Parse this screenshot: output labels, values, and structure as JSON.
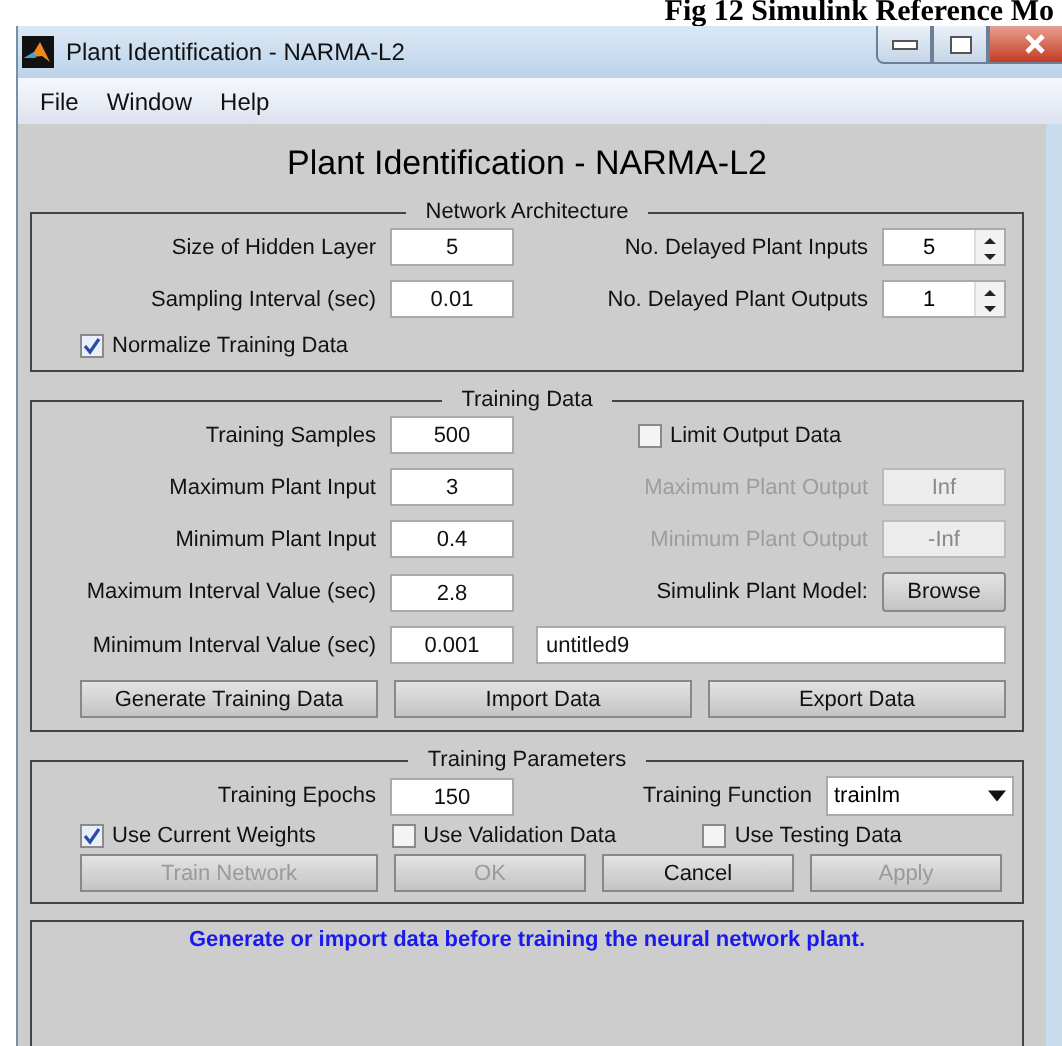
{
  "caption": "Fig 12 Simulink Reference Mo",
  "window": {
    "title": "Plant Identification - NARMA-L2"
  },
  "menu": [
    "File",
    "Window",
    "Help"
  ],
  "heading": "Plant Identification - NARMA-L2",
  "network_architecture": {
    "title": "Network Architecture",
    "fields": [
      {
        "label": "Size of Hidden Layer",
        "value": "5"
      },
      {
        "label": "Sampling Interval (sec)",
        "value": "0.01"
      }
    ],
    "spinners": [
      {
        "label": "No. Delayed Plant Inputs",
        "value": "5"
      },
      {
        "label": "No. Delayed Plant Outputs",
        "value": "1"
      }
    ],
    "normalize": {
      "label": "Normalize Training Data",
      "checked": true
    }
  },
  "training_data": {
    "title": "Training Data",
    "fields": [
      {
        "label": "Training Samples",
        "value": "500"
      },
      {
        "label": "Maximum Plant Input",
        "value": "3"
      },
      {
        "label": "Minimum Plant Input",
        "value": "0.4"
      },
      {
        "label": "Maximum Interval Value (sec)",
        "value": "2.8"
      },
      {
        "label": "Minimum Interval Value (sec)",
        "value": "0.001"
      }
    ],
    "right": [
      {
        "kind": "checkbox",
        "label": "Limit Output Data",
        "checked": false
      },
      {
        "kind": "field",
        "label": "Maximum Plant Output",
        "value": "Inf",
        "disabled": true
      },
      {
        "kind": "field",
        "label": "Minimum Plant Output",
        "value": "-Inf",
        "disabled": true
      },
      {
        "kind": "button",
        "label": "Simulink Plant Model:",
        "button": "Browse"
      },
      {
        "kind": "text",
        "value": "untitled9"
      }
    ],
    "buttons": [
      {
        "label": "Generate Training Data",
        "disabled": false
      },
      {
        "label": "Import Data",
        "disabled": false
      },
      {
        "label": "Export Data",
        "disabled": false
      }
    ]
  },
  "training_parameters": {
    "title": "Training Parameters",
    "epochs": {
      "label": "Training Epochs",
      "value": "150"
    },
    "function": {
      "label": "Training Function",
      "value": "trainlm"
    },
    "options": [
      {
        "label": "Use Current Weights",
        "checked": true
      },
      {
        "label": "Use Validation Data",
        "checked": false
      },
      {
        "label": "Use Testing Data",
        "checked": false
      }
    ],
    "buttons": [
      {
        "label": "Train Network",
        "disabled": true
      },
      {
        "label": "OK",
        "disabled": true
      },
      {
        "label": "Cancel",
        "disabled": false
      },
      {
        "label": "Apply",
        "disabled": true
      }
    ]
  },
  "status": "Generate or import data before training the neural network plant."
}
